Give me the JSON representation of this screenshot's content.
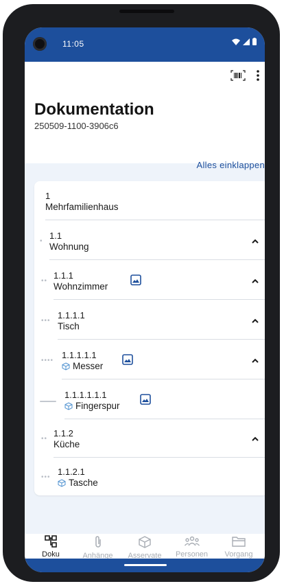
{
  "status_bar": {
    "time": "11:05"
  },
  "header": {
    "title": "Dokumentation",
    "subtitle": "250509-1100-3906c6"
  },
  "actions": {
    "collapse_all": "Alles einklappen"
  },
  "tree": [
    {
      "number": "1",
      "name": "Mehrfamilienhaus"
    },
    {
      "number": "1.1",
      "name": "Wohnung"
    },
    {
      "number": "1.1.1",
      "name": "Wohnzimmer"
    },
    {
      "number": "1.1.1.1",
      "name": "Tisch"
    },
    {
      "number": "1.1.1.1.1",
      "name": "Messer"
    },
    {
      "number": "1.1.1.1.1.1",
      "name": "Fingerspur"
    },
    {
      "number": "1.1.2",
      "name": "Küche"
    },
    {
      "number": "1.1.2.1",
      "name": "Tasche"
    }
  ],
  "bottom_nav": [
    {
      "label": "Doku",
      "icon": "tree-icon",
      "active": true
    },
    {
      "label": "Anhänge",
      "icon": "paperclip-icon"
    },
    {
      "label": "Asservate",
      "icon": "box-icon"
    },
    {
      "label": "Personen",
      "icon": "people-icon"
    },
    {
      "label": "Vorgang",
      "icon": "folder-icon"
    }
  ],
  "colors": {
    "primary": "#1d4f9c",
    "background": "#eef3fa",
    "muted": "#a7acb3"
  }
}
